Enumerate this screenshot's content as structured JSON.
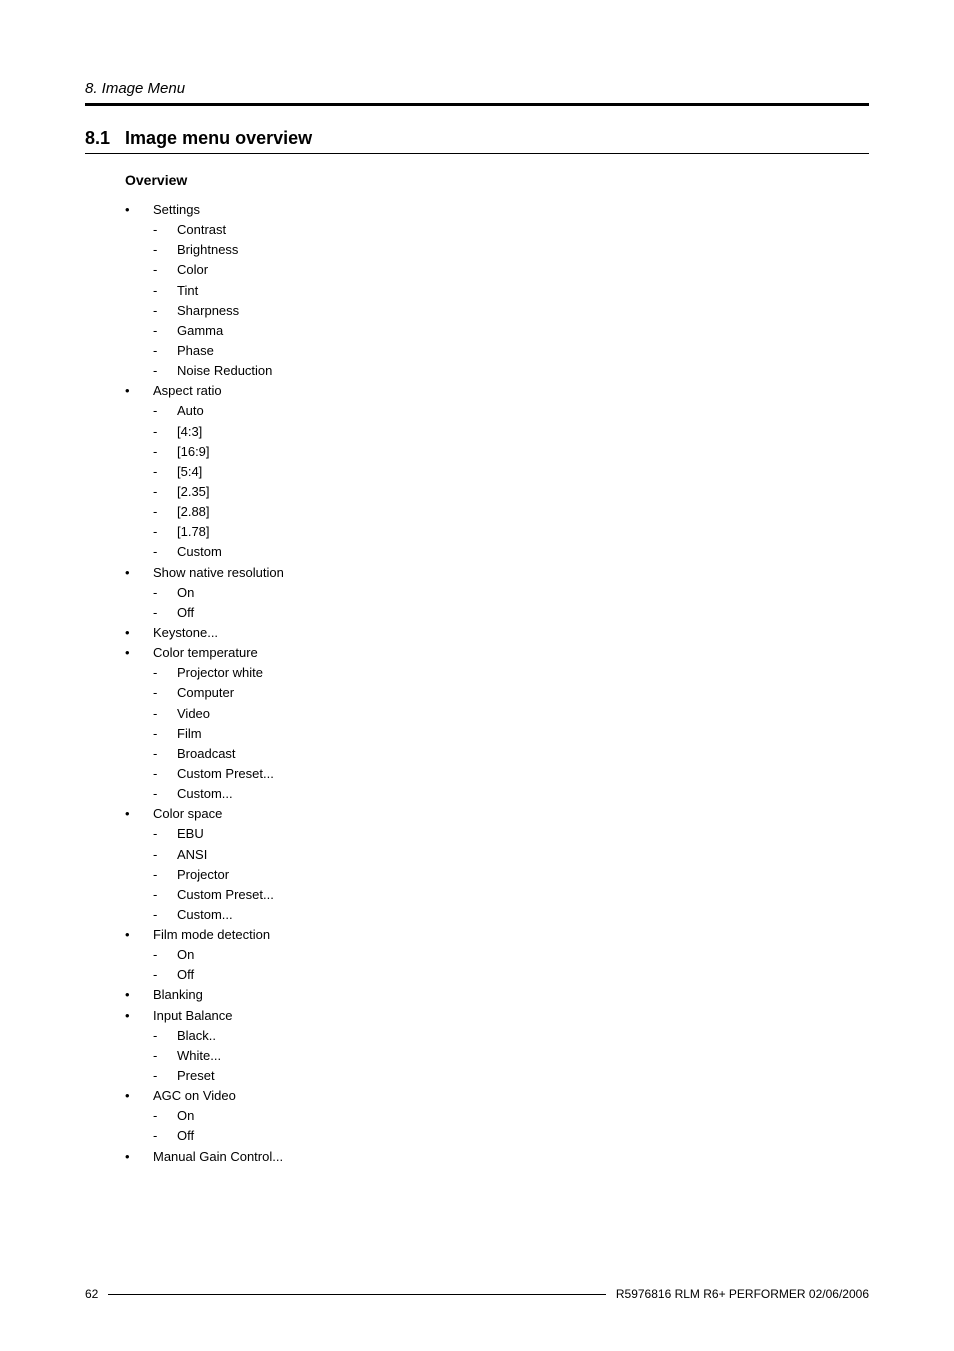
{
  "header": {
    "chapter": "8. Image Menu"
  },
  "section": {
    "number": "8.1",
    "title": "Image menu overview"
  },
  "subsection": {
    "title": "Overview"
  },
  "overview": [
    {
      "label": "Settings",
      "children": [
        "Contrast",
        "Brightness",
        "Color",
        "Tint",
        "Sharpness",
        "Gamma",
        "Phase",
        "Noise Reduction"
      ]
    },
    {
      "label": "Aspect ratio",
      "children": [
        "Auto",
        "[4:3]",
        "[16:9]",
        "[5:4]",
        "[2.35]",
        "[2.88]",
        "[1.78]",
        "Custom"
      ]
    },
    {
      "label": "Show native resolution",
      "children": [
        "On",
        "Off"
      ]
    },
    {
      "label": "Keystone..."
    },
    {
      "label": "Color temperature",
      "children": [
        "Projector white",
        "Computer",
        "Video",
        "Film",
        "Broadcast",
        "Custom Preset...",
        "Custom..."
      ]
    },
    {
      "label": "Color space",
      "children": [
        "EBU",
        "ANSI",
        "Projector",
        "Custom Preset...",
        "Custom..."
      ]
    },
    {
      "label": "Film mode detection",
      "children": [
        "On",
        "Off"
      ]
    },
    {
      "label": "Blanking"
    },
    {
      "label": "Input Balance",
      "children": [
        "Black..",
        "White...",
        "Preset"
      ]
    },
    {
      "label": "AGC on Video",
      "children": [
        "On",
        "Off"
      ]
    },
    {
      "label": "Manual Gain Control..."
    }
  ],
  "footer": {
    "page": "62",
    "docref": "R5976816  RLM R6+ PERFORMER  02/06/2006"
  }
}
